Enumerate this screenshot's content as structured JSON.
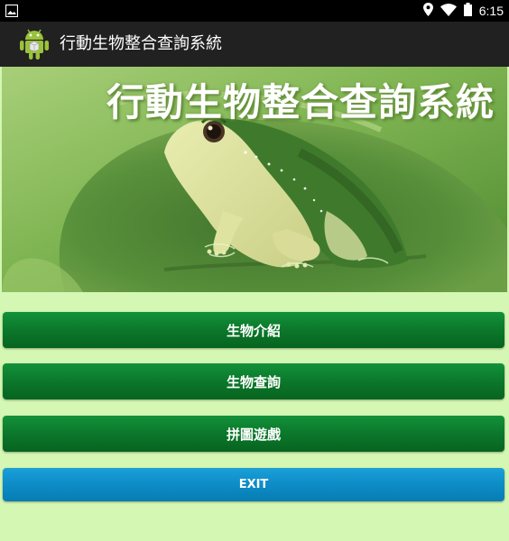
{
  "status_bar": {
    "time": "6:15",
    "icons": [
      "image-icon",
      "location-icon",
      "wifi-icon",
      "battery-icon"
    ]
  },
  "action_bar": {
    "title": "行動生物整合查詢系統",
    "icon": "android-app-icon"
  },
  "banner": {
    "title": "行動生物整合查詢系統",
    "image": "frog-illustration"
  },
  "menu": {
    "intro_label": "生物介紹",
    "query_label": "生物查詢",
    "puzzle_label": "拼圖遊戲",
    "exit_label": "EXIT"
  },
  "colors": {
    "background": "#d4f7b3",
    "button_green": "#0c7a2c",
    "button_blue": "#0d8cc6",
    "action_bar": "#212121"
  }
}
